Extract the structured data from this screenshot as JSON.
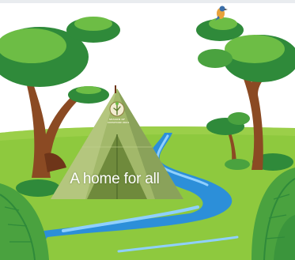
{
  "scene": {
    "caption": "A home for all",
    "badge": {
      "line1": "SEASON OF",
      "line2": "CREATION 2021"
    }
  },
  "palette": {
    "sky": "#ffffff",
    "grass": "#8ec93e",
    "tent_light": "#a2b86a",
    "tent_dark": "#6f8a3c",
    "river": "#2c8fd9",
    "foliage_dark": "#2f8a3a",
    "foliage_light": "#6dbd45",
    "trunk": "#8b4a23",
    "bird": "#e8a23a"
  },
  "icons": [
    "bird-icon",
    "tree-icon",
    "tent-icon",
    "river-icon",
    "leaf-icon",
    "season-of-creation-logo"
  ]
}
